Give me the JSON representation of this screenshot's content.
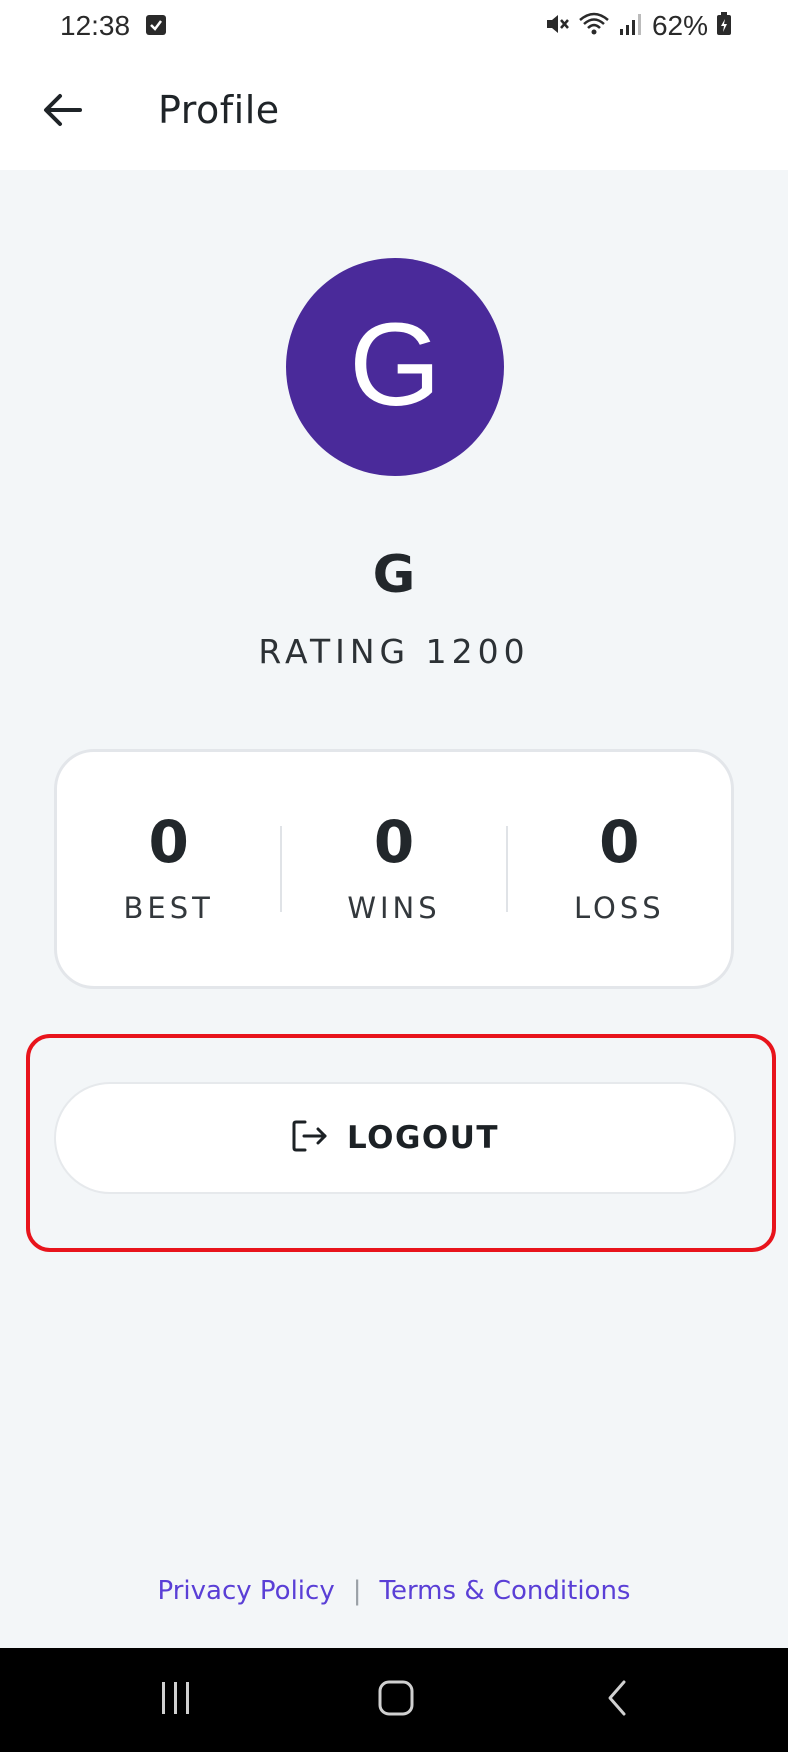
{
  "status_bar": {
    "time": "12:38",
    "battery": "62%",
    "icons": [
      "check-notification-icon",
      "mute-icon",
      "wifi-icon",
      "signal-icon",
      "battery-icon"
    ]
  },
  "app_bar": {
    "title": "Profile",
    "back_icon": "arrow-left-icon"
  },
  "profile": {
    "avatar_letter": "G",
    "avatar_color": "#4a2a9a",
    "name": "G",
    "rating": "RATING 1200"
  },
  "stats": [
    {
      "value": "0",
      "label": "BEST"
    },
    {
      "value": "0",
      "label": "WINS"
    },
    {
      "value": "0",
      "label": "LOSS"
    }
  ],
  "logout": {
    "label": "LOGOUT",
    "icon": "logout-icon",
    "highlight_color": "#e8141c"
  },
  "footer": {
    "privacy": "Privacy Policy",
    "separator": "|",
    "terms": "Terms & Conditions",
    "link_color": "#5a3fd6"
  },
  "nav_bar": {
    "items": [
      "recent-apps-icon",
      "home-icon",
      "back-icon"
    ]
  }
}
